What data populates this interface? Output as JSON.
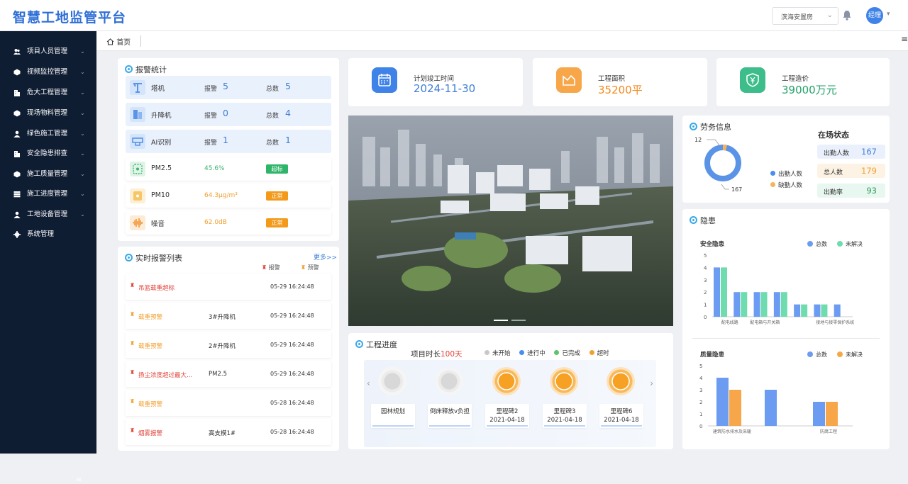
{
  "header": {
    "logo": "智慧工地监管平台",
    "project": "滨海安置房",
    "user": "经理"
  },
  "sidebar": {
    "items": [
      {
        "label": "项目人员管理",
        "icon": "people-icon"
      },
      {
        "label": "视频监控管理",
        "icon": "camera-icon"
      },
      {
        "label": "危大工程管理",
        "icon": "building-icon"
      },
      {
        "label": "现场物料管理",
        "icon": "box-icon"
      },
      {
        "label": "绿色施工管理",
        "icon": "person-icon"
      },
      {
        "label": "安全隐患排查",
        "icon": "building-icon"
      },
      {
        "label": "施工质量管理",
        "icon": "box-icon"
      },
      {
        "label": "施工进度管理",
        "icon": "storage-icon"
      },
      {
        "label": "工地设备管理",
        "icon": "person-icon"
      },
      {
        "label": "系统管理",
        "icon": "gear-icon"
      }
    ]
  },
  "tabs": {
    "home": "首页"
  },
  "alarm_stats": {
    "title": "报警统计",
    "alarm_label": "报警",
    "total_label": "总数",
    "devices": [
      {
        "name": "塔机",
        "alarm": "5",
        "total": "5"
      },
      {
        "name": "升降机",
        "alarm": "0",
        "total": "4"
      },
      {
        "name": "AI识别",
        "alarm": "1",
        "total": "1"
      }
    ],
    "env": [
      {
        "name": "PM2.5",
        "value": "45.6%",
        "status": "超标",
        "color": "#3cb371",
        "badge": "#2fb56a"
      },
      {
        "name": "PM10",
        "value": "64.3μg/m³",
        "status": "正常",
        "color": "#f0a030",
        "badge": "#f39a1a"
      },
      {
        "name": "噪音",
        "value": "62.0dB",
        "status": "正常",
        "color": "#f0a030",
        "badge": "#f39a1a"
      }
    ]
  },
  "realtime": {
    "title": "实时报警列表",
    "more": "更多>>",
    "legend_alarm": "报警",
    "legend_warn": "预警",
    "rows": [
      {
        "type": "吊篮载重超标",
        "device": "",
        "time": "05-29 16:24:48",
        "level": "alarm"
      },
      {
        "type": "载重预警",
        "device": "3#升降机",
        "time": "05-29 16:24:48",
        "level": "warn"
      },
      {
        "type": "载重预警",
        "device": "2#升降机",
        "time": "05-29 16:24:48",
        "level": "warn"
      },
      {
        "type": "扬尘浓度超过最大...",
        "device": "PM2.5",
        "time": "05-29 16:24:48",
        "level": "alarm"
      },
      {
        "type": "载重预警",
        "device": "",
        "time": "05-28 16:24:48",
        "level": "warn"
      },
      {
        "type": "烟雾报警",
        "device": "高支模1#",
        "time": "05-28 16:24:48",
        "level": "alarm"
      }
    ]
  },
  "stats": [
    {
      "label": "计划竣工时间",
      "value": "2024-11-30",
      "color": "#3f82e8",
      "val_color": "#3f7ed8",
      "icon": "calendar-icon"
    },
    {
      "label": "工程面积",
      "value": "35200平",
      "color": "#f7a74a",
      "val_color": "#f28a1e",
      "icon": "area-icon"
    },
    {
      "label": "工程造价",
      "value": "39000万元",
      "color": "#3dbd8a",
      "val_color": "#23a36b",
      "icon": "money-shield-icon"
    }
  ],
  "progress": {
    "title": "工程进度",
    "duration_label": "项目时长",
    "duration_value": "100天",
    "legend": [
      {
        "label": "未开始",
        "color": "#c8c8c8"
      },
      {
        "label": "进行中",
        "color": "#4a8cf0"
      },
      {
        "label": "已完成",
        "color": "#5cc46a"
      },
      {
        "label": "超时",
        "color": "#f0a030"
      }
    ],
    "milestones": [
      {
        "name": "园林规划",
        "date": "",
        "state": "gray"
      },
      {
        "name": "倒床释放v负担",
        "date": "",
        "state": "gray"
      },
      {
        "name": "里程碑2",
        "date": "2021-04-18",
        "state": "orange"
      },
      {
        "name": "里程碑3",
        "date": "2021-04-18",
        "state": "orange"
      },
      {
        "name": "里程碑6",
        "date": "2021-04-18",
        "state": "orange"
      }
    ]
  },
  "labor": {
    "title": "劳务信息",
    "status_title": "在场状态",
    "donut_present": "12",
    "donut_absent": "167",
    "legend_present": "出勤人数",
    "legend_absent": "缺勤人数",
    "stats": [
      {
        "label": "出勤人数",
        "value": "167",
        "bg": "#eaf1fd",
        "color": "#3f7ed8"
      },
      {
        "label": "总人数",
        "value": "179",
        "bg": "#fdf3e4",
        "color": "#f0a030"
      },
      {
        "label": "出勤率",
        "value": "93",
        "bg": "#e8f7ef",
        "color": "#2c9a5e"
      }
    ]
  },
  "hazard": {
    "title": "隐患"
  },
  "chart_data": [
    {
      "type": "bar",
      "title": "安全隐患",
      "categories": [
        "配电线路",
        "配电箱与开关箱",
        "",
        "接地与接零保护系统"
      ],
      "ylim": [
        0,
        5
      ],
      "yticks": [
        "0",
        "1",
        "2",
        "3",
        "4",
        "5"
      ],
      "series": [
        {
          "name": "总数",
          "color": "#6c9cf2",
          "values": [
            4,
            2,
            2,
            2,
            1,
            1,
            1
          ]
        },
        {
          "name": "未解决",
          "color": "#6fdcb0",
          "values": [
            4,
            2,
            2,
            2,
            1,
            1,
            0
          ]
        }
      ]
    },
    {
      "type": "bar",
      "title": "质量隐患",
      "categories": [
        "建筑防水排水及采暖",
        "",
        "防腐工程"
      ],
      "ylim": [
        0,
        5
      ],
      "yticks": [
        "0",
        "1",
        "2",
        "3",
        "4",
        "5"
      ],
      "series": [
        {
          "name": "总数",
          "color": "#6c9cf2",
          "values": [
            4,
            3,
            2
          ]
        },
        {
          "name": "未解决",
          "color": "#f7a74a",
          "values": [
            3,
            0,
            2
          ]
        }
      ]
    }
  ]
}
